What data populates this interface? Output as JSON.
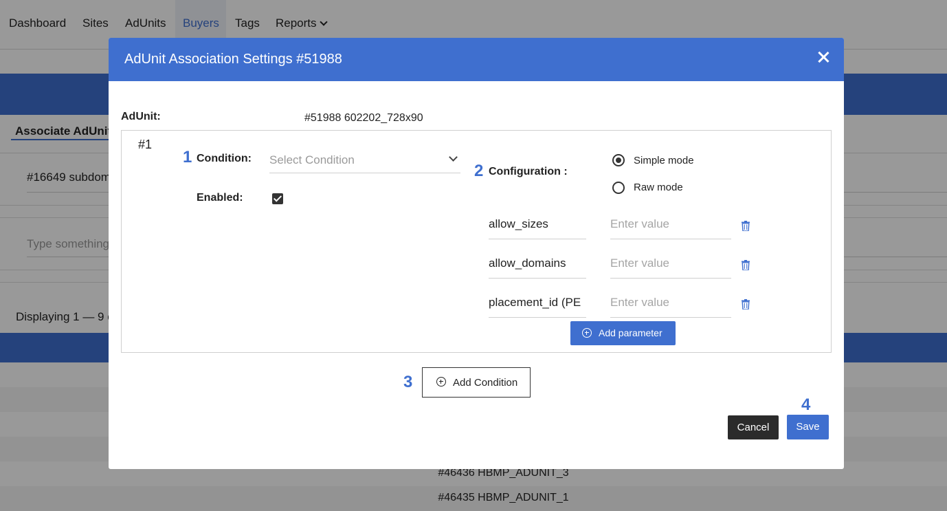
{
  "nav": {
    "items": [
      {
        "label": "Dashboard"
      },
      {
        "label": "Sites"
      },
      {
        "label": "AdUnits"
      },
      {
        "label": "Buyers",
        "active": true
      },
      {
        "label": "Tags"
      },
      {
        "label": "Reports"
      }
    ]
  },
  "background": {
    "tab_label": "Associate AdUnits",
    "row_text": "#16649 subdom",
    "search_placeholder": "Type something",
    "displaying_text": "Displaying 1 — 9 c",
    "rows": [
      "#46436 HBMP_ADUNIT_3",
      "#46435 HBMP_ADUNIT_1"
    ]
  },
  "modal": {
    "title": "AdUnit Association Settings #51988",
    "adunit_label": "AdUnit:",
    "adunit_value": "#51988 602202_728x90",
    "condition_block": {
      "index_label": "#1",
      "condition_label": "Condition:",
      "condition_placeholder": "Select Condition",
      "enabled_label": "Enabled:",
      "enabled": true,
      "configuration_label": "Configuration :",
      "modes": [
        {
          "label": "Simple mode",
          "selected": true
        },
        {
          "label": "Raw mode",
          "selected": false
        }
      ],
      "parameters": [
        {
          "key": "allow_sizes",
          "value_placeholder": "Enter value"
        },
        {
          "key": "allow_domains",
          "value_placeholder": "Enter value"
        },
        {
          "key": "placement_id (PE",
          "value_placeholder": "Enter value"
        }
      ],
      "add_parameter_label": "Add parameter"
    },
    "add_condition_label": "Add Condition",
    "cancel_label": "Cancel",
    "save_label": "Save",
    "step_markers": [
      "1",
      "2",
      "3",
      "4"
    ]
  },
  "colors": {
    "accent": "#3f6fcf",
    "dark_button": "#2b2b2b",
    "overlay": "rgba(0,0,0,0.40)"
  },
  "icons": [
    "close-icon",
    "chevron-down-icon",
    "checkbox-checked-icon",
    "trash-icon",
    "plus-circle-icon"
  ]
}
